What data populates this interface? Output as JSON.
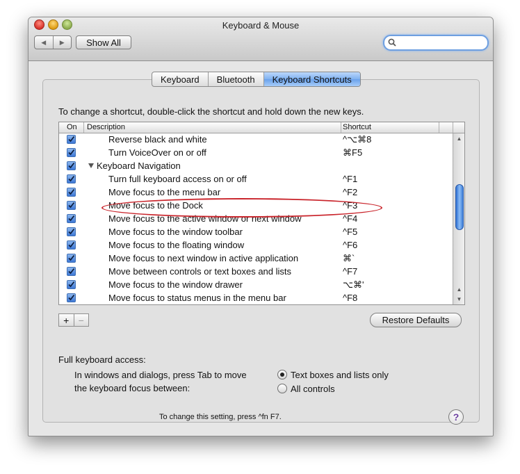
{
  "window": {
    "title": "Keyboard & Mouse"
  },
  "toolbar": {
    "back_label": "◀",
    "forward_label": "▶",
    "show_all_label": "Show All",
    "search_value": ""
  },
  "tabs": [
    {
      "label": "Keyboard",
      "active": false
    },
    {
      "label": "Bluetooth",
      "active": false
    },
    {
      "label": "Keyboard Shortcuts",
      "active": true
    }
  ],
  "instruction": "To change a shortcut, double-click the shortcut and hold down the new keys.",
  "table": {
    "headers": {
      "on": "On",
      "description": "Description",
      "shortcut": "Shortcut"
    },
    "rows": [
      {
        "desc": "Reverse black and white",
        "shortcut": "^⌥⌘8",
        "indent": 2
      },
      {
        "desc": "Turn VoiceOver on or off",
        "shortcut": "⌘F5",
        "indent": 2
      },
      {
        "desc": "Keyboard Navigation",
        "shortcut": "",
        "indent": 1,
        "group": true
      },
      {
        "desc": "Turn full keyboard access on or off",
        "shortcut": "^F1",
        "indent": 2
      },
      {
        "desc": "Move focus to the menu bar",
        "shortcut": "^F2",
        "indent": 2
      },
      {
        "desc": "Move focus to the Dock",
        "shortcut": "^F3",
        "indent": 2
      },
      {
        "desc": "Move focus to the active window or next window",
        "shortcut": "^F4",
        "indent": 2
      },
      {
        "desc": "Move focus to the window toolbar",
        "shortcut": "^F5",
        "indent": 2
      },
      {
        "desc": "Move focus to the floating window",
        "shortcut": "^F6",
        "indent": 2
      },
      {
        "desc": "Move focus to next window in active application",
        "shortcut": "⌘`",
        "indent": 2
      },
      {
        "desc": "Move between controls or text boxes and lists",
        "shortcut": "^F7",
        "indent": 2
      },
      {
        "desc": "Move focus to the window drawer",
        "shortcut": "⌥⌘'",
        "indent": 2
      },
      {
        "desc": "Move focus to status menus in the menu bar",
        "shortcut": "^F8",
        "indent": 2
      }
    ]
  },
  "buttons": {
    "add": "+",
    "remove": "−",
    "restore_defaults": "Restore Defaults",
    "help": "?"
  },
  "full_keyboard_access": {
    "label": "Full keyboard access:",
    "desc_line1": "In windows and dialogs, press Tab to move",
    "desc_line2": "the keyboard focus between:",
    "option1": "Text boxes and lists only",
    "option2": "All controls",
    "selected": "option1",
    "note": "To change this setting, press ^fn F7."
  },
  "colors": {
    "accent": "#3d78d6",
    "highlight_ellipse": "#c9232a"
  }
}
